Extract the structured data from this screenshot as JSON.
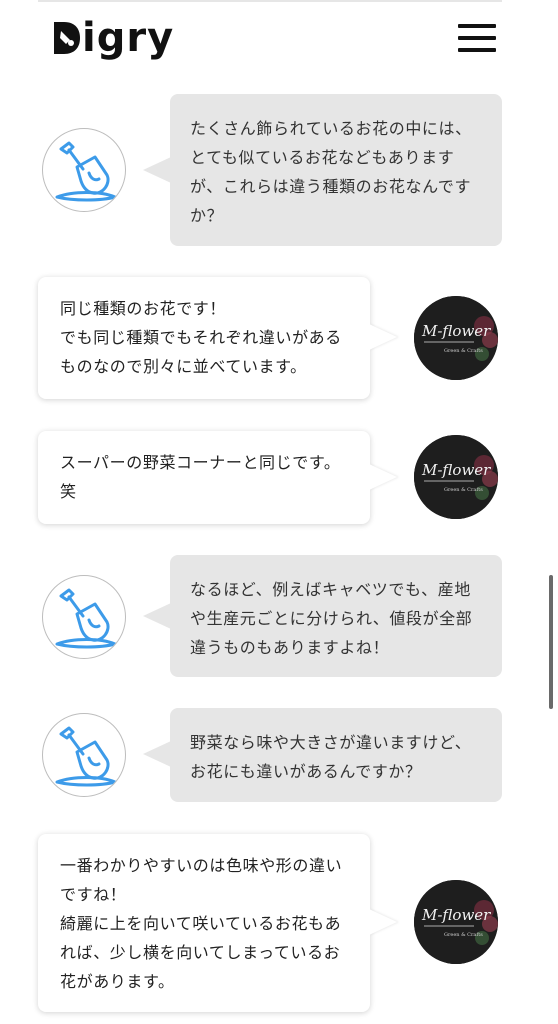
{
  "header": {
    "logo_text": "igry",
    "menu_icon": "hamburger-menu-icon"
  },
  "colors": {
    "user_bubble": "#e6e6e6",
    "shop_bubble": "#ffffff",
    "user_icon_blue": "#3d9be9"
  },
  "shop_avatar": {
    "logo_text": "M-flower",
    "tagline": "Green & Crafts"
  },
  "messages": [
    {
      "speaker": "user",
      "text": "たくさん飾られているお花の中には、\nとても似ているお花などもありますが、これらは違う種類のお花なんですか？"
    },
    {
      "speaker": "shop",
      "text": "同じ種類のお花です！\nでも同じ種類でもそれぞれ違いがあるものなので別々に並べています。"
    },
    {
      "speaker": "shop",
      "text": "スーパーの野菜コーナーと同じです。笑"
    },
    {
      "speaker": "user",
      "text": "なるほど、例えばキャベツでも、産地や生産元ごとに分けられ、値段が全部違うものもありますよね！"
    },
    {
      "speaker": "user",
      "text": "野菜なら味や大きさが違いますけど、お花にも違いがあるんですか？"
    },
    {
      "speaker": "shop",
      "text": "一番わかりやすいのは色味や形の違いですね！\n綺麗に上を向いて咲いているお花もあれば、少し横を向いてしまっているお花があります。"
    }
  ]
}
